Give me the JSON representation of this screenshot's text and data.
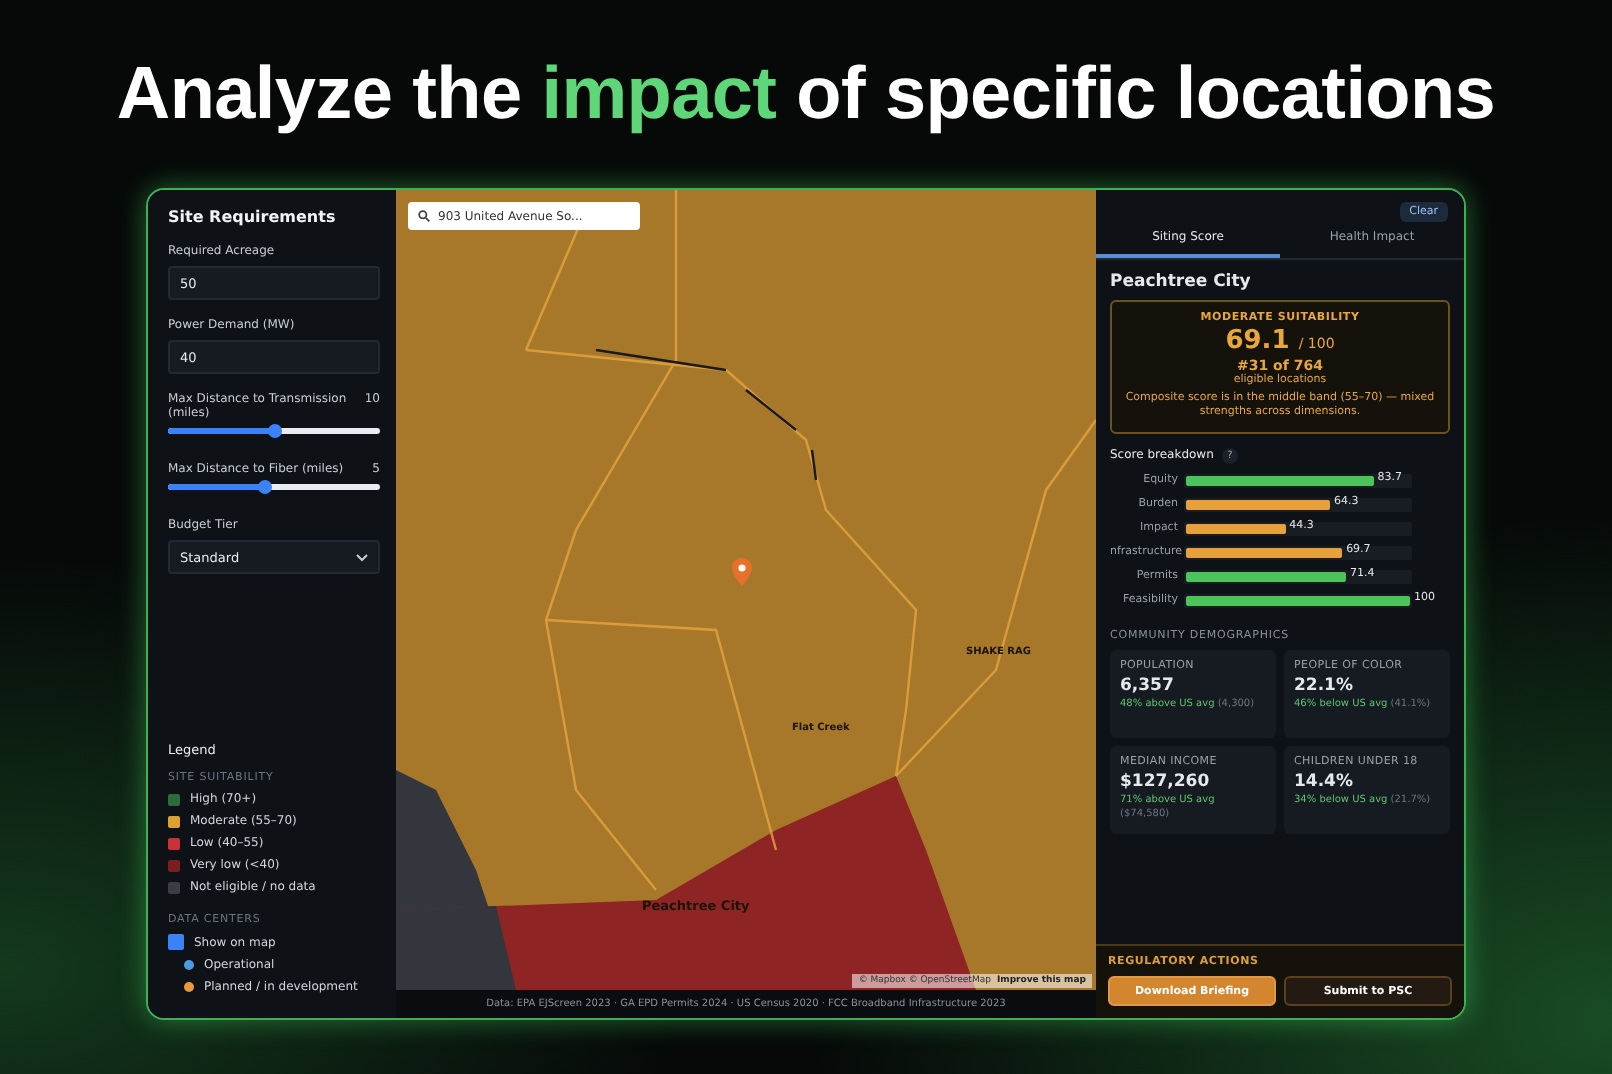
{
  "headline": {
    "before": "Analyze the ",
    "highlight": "impact",
    "after": " of specific locations"
  },
  "requirements": {
    "title": "Site Requirements",
    "fields": [
      {
        "kind": "input",
        "label": "Required Acreage",
        "value": "50"
      },
      {
        "kind": "input",
        "label": "Power Demand (MW)",
        "value": "40"
      },
      {
        "kind": "slider",
        "label": "Max Distance to Transmission (miles)",
        "reading": "10",
        "level": 0.5
      },
      {
        "kind": "slider",
        "label": "Max Distance to Fiber (miles)",
        "reading": "5",
        "level": 0.45
      },
      {
        "kind": "select",
        "label": "Budget Tier",
        "value": "Standard"
      }
    ]
  },
  "legend": {
    "title": "Legend",
    "suitability_heading": "SITE SUITABILITY",
    "suitability": [
      {
        "label": "High (70+)",
        "color": "#2f6b3a"
      },
      {
        "label": "Moderate (55–70)",
        "color": "#e0a030"
      },
      {
        "label": "Low (40–55)",
        "color": "#c8303a"
      },
      {
        "label": "Very low (<40)",
        "color": "#7a1e22"
      },
      {
        "label": "Not eligible / no data",
        "color": "#3a3d44"
      }
    ],
    "data_centers_heading": "DATA CENTERS",
    "show_on_map": {
      "label": "Show on map",
      "checked": true
    },
    "data_centers": [
      {
        "label": "Operational",
        "color": "#4a9be0"
      },
      {
        "label": "Planned / in development",
        "color": "#e89a3c"
      }
    ]
  },
  "map": {
    "search": {
      "value": "903 United Avenue So..."
    },
    "labels": [
      {
        "text": "SHAKE RAG",
        "kind": "area"
      },
      {
        "text": "Flat Creek",
        "kind": "area"
      },
      {
        "text": "Peachtree City",
        "kind": "city"
      }
    ],
    "attribution": "© Mapbox © OpenStreetMap",
    "improve_link": "Improve this map"
  },
  "footer": "Data: EPA EJScreen 2023 · GA EPD Permits 2024 · US Census 2020 · FCC Broadband Infrastructure 2023",
  "panel": {
    "clear_button": "Clear",
    "tabs": [
      {
        "label": "Siting Score",
        "selected": true
      },
      {
        "label": "Health Impact",
        "selected": false
      }
    ],
    "place": "Peachtree City",
    "score": {
      "band": "MODERATE SUITABILITY",
      "value": "69.1",
      "scale": "/ 100",
      "rank": "#31 of 764",
      "rank_caption": "eligible locations",
      "note": "Composite score is in the middle band (55–70) — mixed strengths across dimensions."
    },
    "breakdown_title": "Score breakdown",
    "help": "?",
    "breakdown": [
      {
        "label": "Equity",
        "value": "83.7",
        "level": 0.837,
        "color": "#4cc45a"
      },
      {
        "label": "Burden",
        "value": "64.3",
        "level": 0.643,
        "color": "#e8a03c"
      },
      {
        "label": "Impact",
        "value": "44.3",
        "level": 0.443,
        "color": "#e8a03c"
      },
      {
        "label": "nfrastructure",
        "value": "69.7",
        "level": 0.697,
        "color": "#e8a03c"
      },
      {
        "label": "Permits",
        "value": "71.4",
        "level": 0.714,
        "color": "#4cc45a"
      },
      {
        "label": "Feasibility",
        "value": "100",
        "level": 1,
        "color": "#4cc45a"
      }
    ],
    "demographics_heading": "COMMUNITY DEMOGRAPHICS",
    "demographics": [
      {
        "label": "POPULATION",
        "value": "6,357",
        "compare": "48% above US avg",
        "baseline": "(4,300)"
      },
      {
        "label": "PEOPLE OF COLOR",
        "value": "22.1%",
        "compare": "46% below US avg",
        "baseline": "(41.1%)"
      },
      {
        "label": "MEDIAN INCOME",
        "value": "$127,260",
        "compare": "71% above US avg",
        "baseline": "($74,580)"
      },
      {
        "label": "CHILDREN UNDER 18",
        "value": "14.4%",
        "compare": "34% below US avg",
        "baseline": "(21.7%)"
      }
    ],
    "actions_heading": "REGULATORY ACTIONS",
    "actions": [
      {
        "label": "Download Briefing",
        "kind": "primary"
      },
      {
        "label": "Submit to PSC",
        "kind": "secondary"
      }
    ]
  }
}
